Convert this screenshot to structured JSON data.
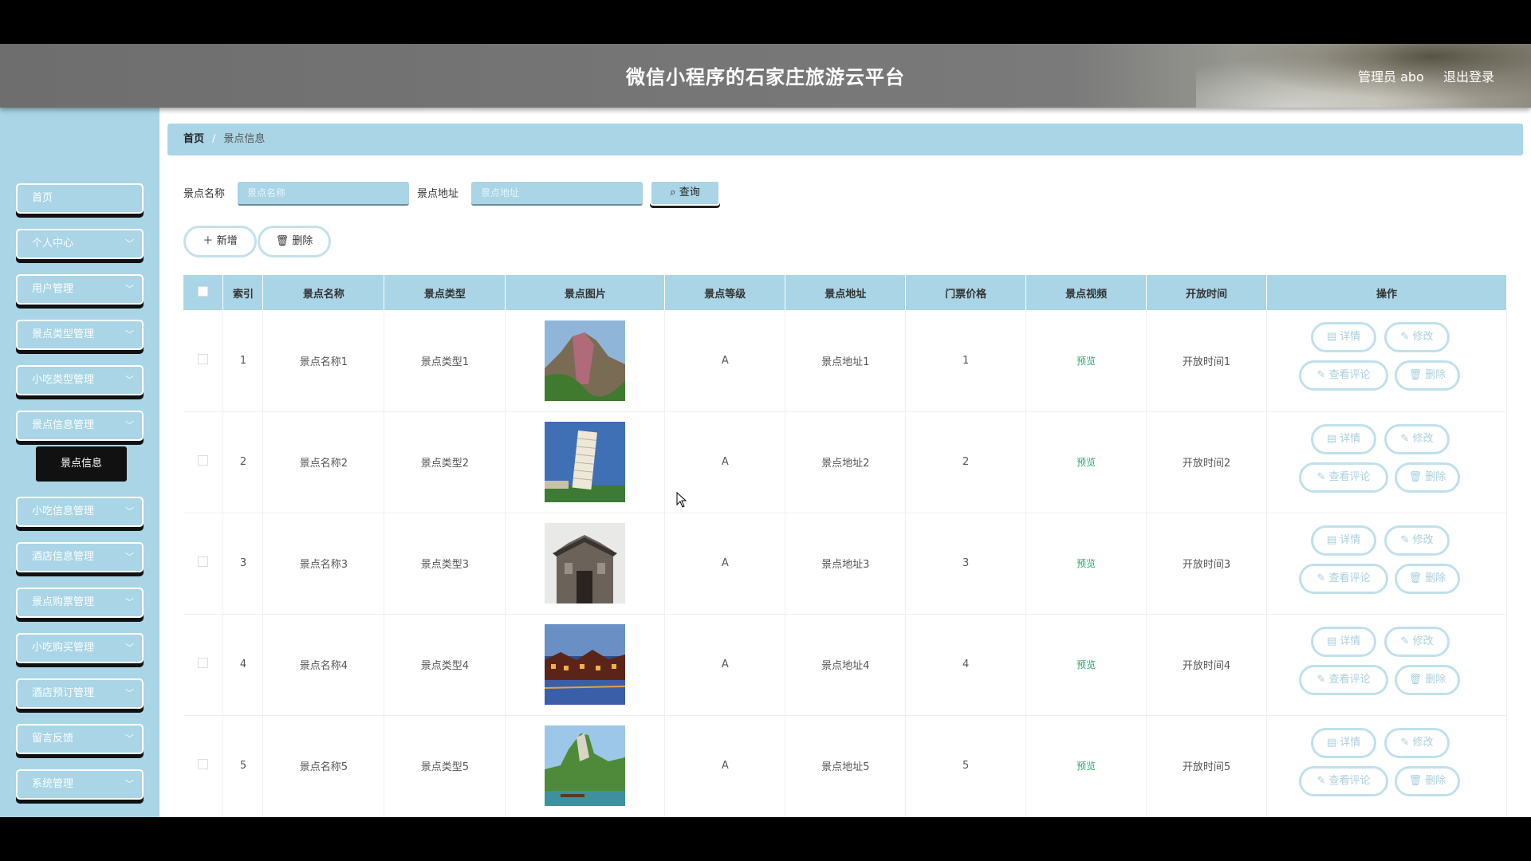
{
  "header": {
    "title": "微信小程序的石家庄旅游云平台",
    "admin": "管理员 abo",
    "logout": "退出登录"
  },
  "sidebar": {
    "items": [
      {
        "label": "首页",
        "has_chevron": false
      },
      {
        "label": "个人中心",
        "has_chevron": true
      },
      {
        "label": "用户管理",
        "has_chevron": true
      },
      {
        "label": "景点类型管理",
        "has_chevron": true
      },
      {
        "label": "小吃类型管理",
        "has_chevron": true
      },
      {
        "label": "景点信息管理",
        "has_chevron": true
      },
      {
        "label": "小吃信息管理",
        "has_chevron": true
      },
      {
        "label": "酒店信息管理",
        "has_chevron": true
      },
      {
        "label": "景点购票管理",
        "has_chevron": true
      },
      {
        "label": "小吃购买管理",
        "has_chevron": true
      },
      {
        "label": "酒店预订管理",
        "has_chevron": true
      },
      {
        "label": "留言反馈",
        "has_chevron": true
      },
      {
        "label": "系统管理",
        "has_chevron": true
      }
    ],
    "active_submenu": "景点信息"
  },
  "breadcrumb": {
    "home": "首页",
    "current": "景点信息"
  },
  "search": {
    "name_label": "景点名称",
    "name_placeholder": "景点名称",
    "address_label": "景点地址",
    "address_placeholder": "景点地址",
    "query_label": "查询"
  },
  "actions": {
    "add_label": "新增",
    "delete_label": "删除"
  },
  "table": {
    "headers": [
      "索引",
      "景点名称",
      "景点类型",
      "景点图片",
      "景点等级",
      "景点地址",
      "门票价格",
      "景点视频",
      "开放时间",
      "操作"
    ],
    "rows": [
      {
        "index": "1",
        "name": "景点名称1",
        "type": "景点类型1",
        "image": "mountain-cliff",
        "level": "A",
        "address": "景点地址1",
        "price": "1",
        "video": "预览",
        "open_time": "开放时间1"
      },
      {
        "index": "2",
        "name": "景点名称2",
        "type": "景点类型2",
        "image": "leaning-tower",
        "level": "A",
        "address": "景点地址2",
        "price": "2",
        "video": "预览",
        "open_time": "开放时间2"
      },
      {
        "index": "3",
        "name": "景点名称3",
        "type": "景点类型3",
        "image": "ancient-gate",
        "level": "A",
        "address": "景点地址3",
        "price": "3",
        "video": "预览",
        "open_time": "开放时间3"
      },
      {
        "index": "4",
        "name": "景点名称4",
        "type": "景点类型4",
        "image": "night-town",
        "level": "A",
        "address": "景点地址4",
        "price": "4",
        "video": "预览",
        "open_time": "开放时间4"
      },
      {
        "index": "5",
        "name": "景点名称5",
        "type": "景点类型5",
        "image": "river-peak",
        "level": "A",
        "address": "景点地址5",
        "price": "5",
        "video": "预览",
        "open_time": "开放时间5"
      }
    ],
    "ops": {
      "detail": "详情",
      "edit": "修改",
      "comments": "查看评论",
      "delete": "删除"
    }
  },
  "colors": {
    "accent": "#a9d5e6",
    "preview_green": "#2ea86b"
  }
}
